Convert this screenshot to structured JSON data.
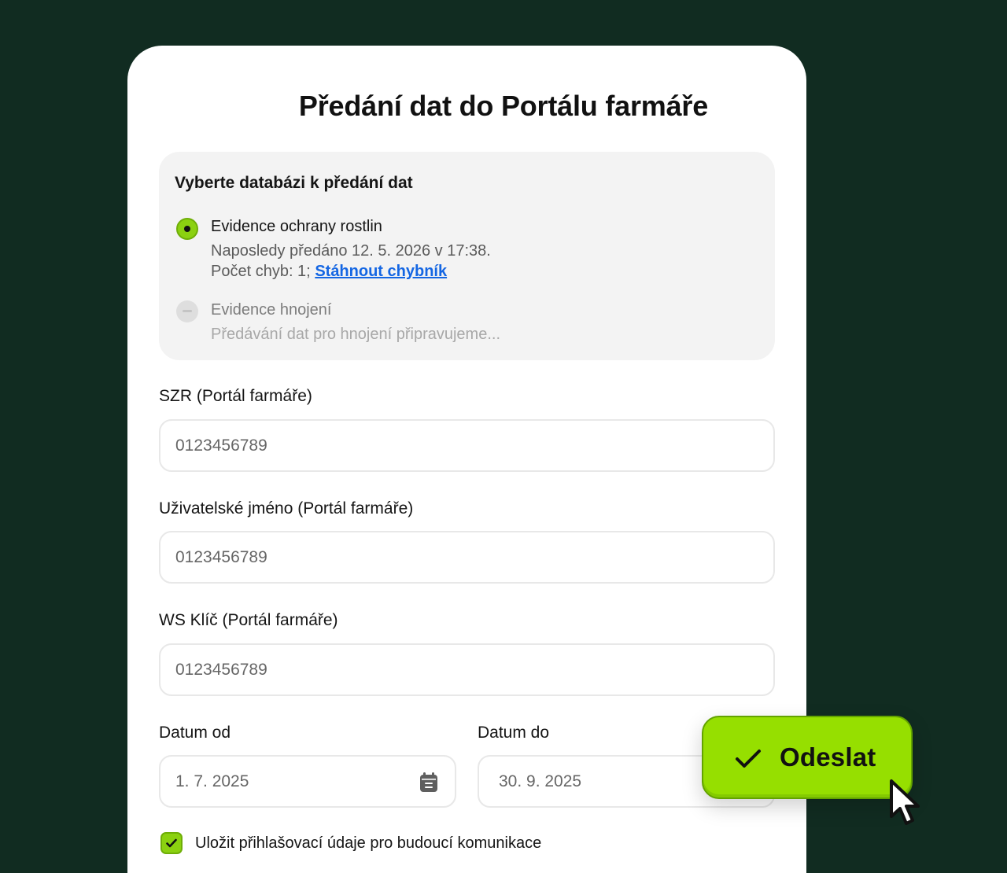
{
  "dialog": {
    "title": "Předání dat do Portálu farmáře"
  },
  "database_select": {
    "heading": "Vyberte databázi k předání dat",
    "options": [
      {
        "label": "Evidence ochrany rostlin",
        "selected": true,
        "status_line": "Naposledy předáno 12. 5. 2026 v 17:38.",
        "error_prefix": "Počet chyb: 1;",
        "error_link": "Stáhnout chybník"
      },
      {
        "label": "Evidence hnojení",
        "selected": false,
        "disabled": true,
        "status_line": "Předávání dat pro hnojení připravujeme..."
      }
    ]
  },
  "fields": {
    "szr": {
      "label": "SZR (Portál farmáře)",
      "placeholder": "0123456789"
    },
    "username": {
      "label": "Uživatelské jméno (Portál farmáře)",
      "placeholder": "0123456789"
    },
    "ws_key": {
      "label": "WS Klíč (Portál farmáře)",
      "placeholder": "0123456789"
    },
    "date_from": {
      "label": "Datum od",
      "value": "1. 7. 2025"
    },
    "date_to": {
      "label": "Datum do",
      "value": "30. 9. 2025"
    }
  },
  "remember": {
    "checked": true,
    "label": "Uložit přihlašovací údaje pro budoucí komunikace"
  },
  "submit": {
    "label": "Odeslat"
  },
  "colors": {
    "background": "#112c21",
    "accent": "#96df00",
    "link": "#1466e3"
  }
}
